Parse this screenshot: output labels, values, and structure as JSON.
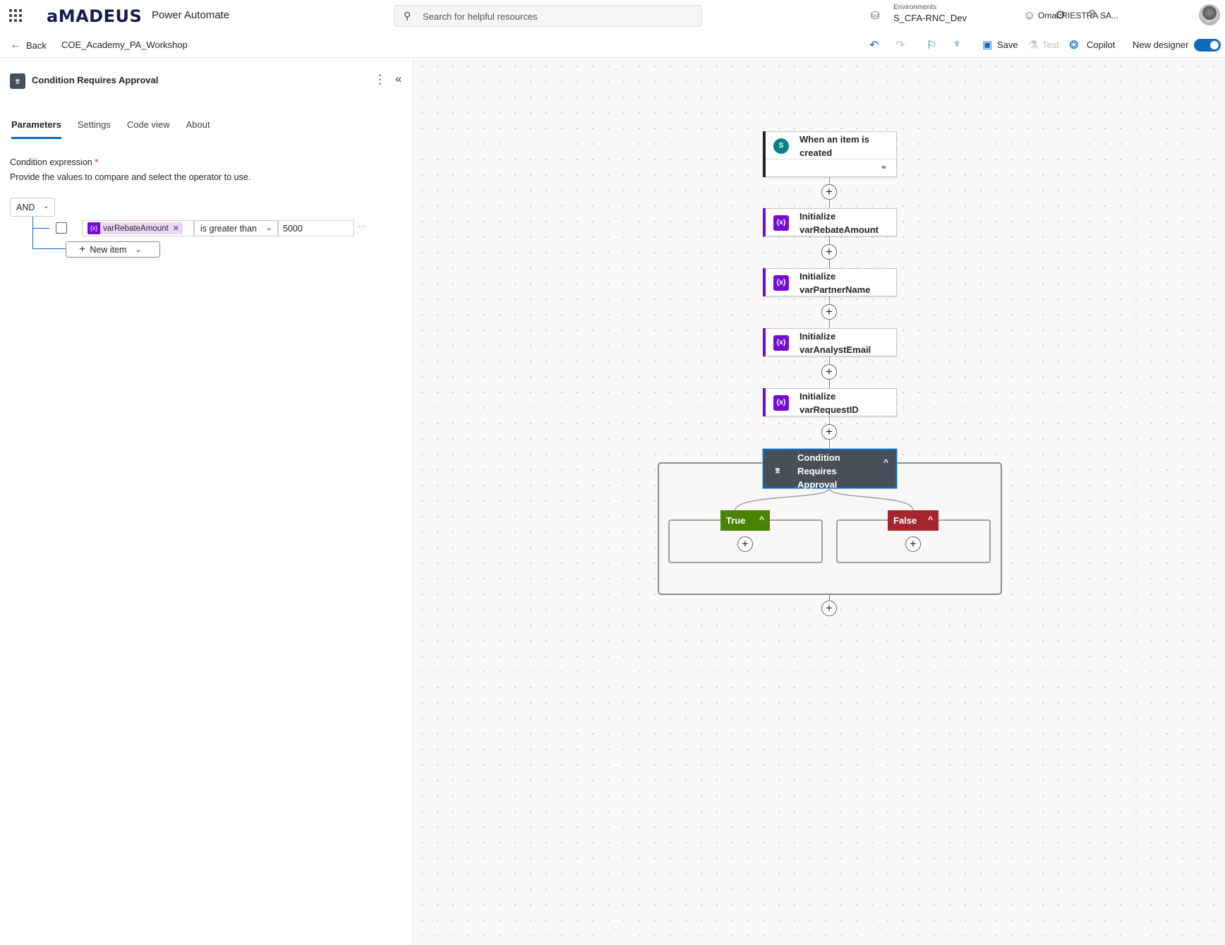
{
  "header": {
    "brand": "aMADEUS",
    "product": "Power Automate",
    "search_placeholder": "Search for helpful resources",
    "env_label": "Environments",
    "env_name": "S_CFA-RNC_Dev",
    "user_name": "Omar RIESTRA SA..."
  },
  "command_bar": {
    "back_label": "Back",
    "flow_name": "COE_Academy_PA_Workshop",
    "save_label": "Save",
    "test_label": "Test",
    "copilot_label": "Copilot",
    "new_designer_label": "New designer",
    "new_designer_on": true
  },
  "panel": {
    "title": "Condition Requires Approval",
    "tabs": [
      {
        "label": "Parameters",
        "active": true
      },
      {
        "label": "Settings",
        "active": false
      },
      {
        "label": "Code view",
        "active": false
      },
      {
        "label": "About",
        "active": false
      }
    ],
    "condition_label": "Condition expression",
    "required_mark": "*",
    "condition_desc": "Provide the values to compare and select the operator to use.",
    "group_operator": "AND",
    "row": {
      "token": "varRebateAmount",
      "operator": "is greater than",
      "value": "5000"
    },
    "new_item_label": "New item"
  },
  "canvas": {
    "trigger": {
      "line1": "When an item is",
      "line2": "created"
    },
    "actions": [
      {
        "line1": "Initialize",
        "line2": "varRebateAmount"
      },
      {
        "line1": "Initialize",
        "line2": "varPartnerName"
      },
      {
        "line1": "Initialize",
        "line2": "varAnalystEmail"
      },
      {
        "line1": "Initialize",
        "line2": "varRequestID"
      }
    ],
    "condition": {
      "line1": "Condition",
      "line2": "Requires",
      "line3": "Approval"
    },
    "true_label": "True",
    "false_label": "False"
  },
  "colors": {
    "accent": "#0f6cbd",
    "variable": "#770bd6",
    "condition": "#484f58",
    "true": "#498205",
    "false": "#a4262c",
    "sharepoint": "#038387"
  },
  "icons": {
    "waffle": "app-launcher-icon",
    "search": "search-icon",
    "environment": "environment-icon",
    "feedback": "smiley-icon",
    "settings": "gear-icon",
    "help": "help-icon",
    "undo": "undo-icon",
    "redo": "redo-icon",
    "flow_checker": "flow-checker-icon",
    "save": "save-icon",
    "test": "flask-icon",
    "copilot": "copilot-icon"
  }
}
